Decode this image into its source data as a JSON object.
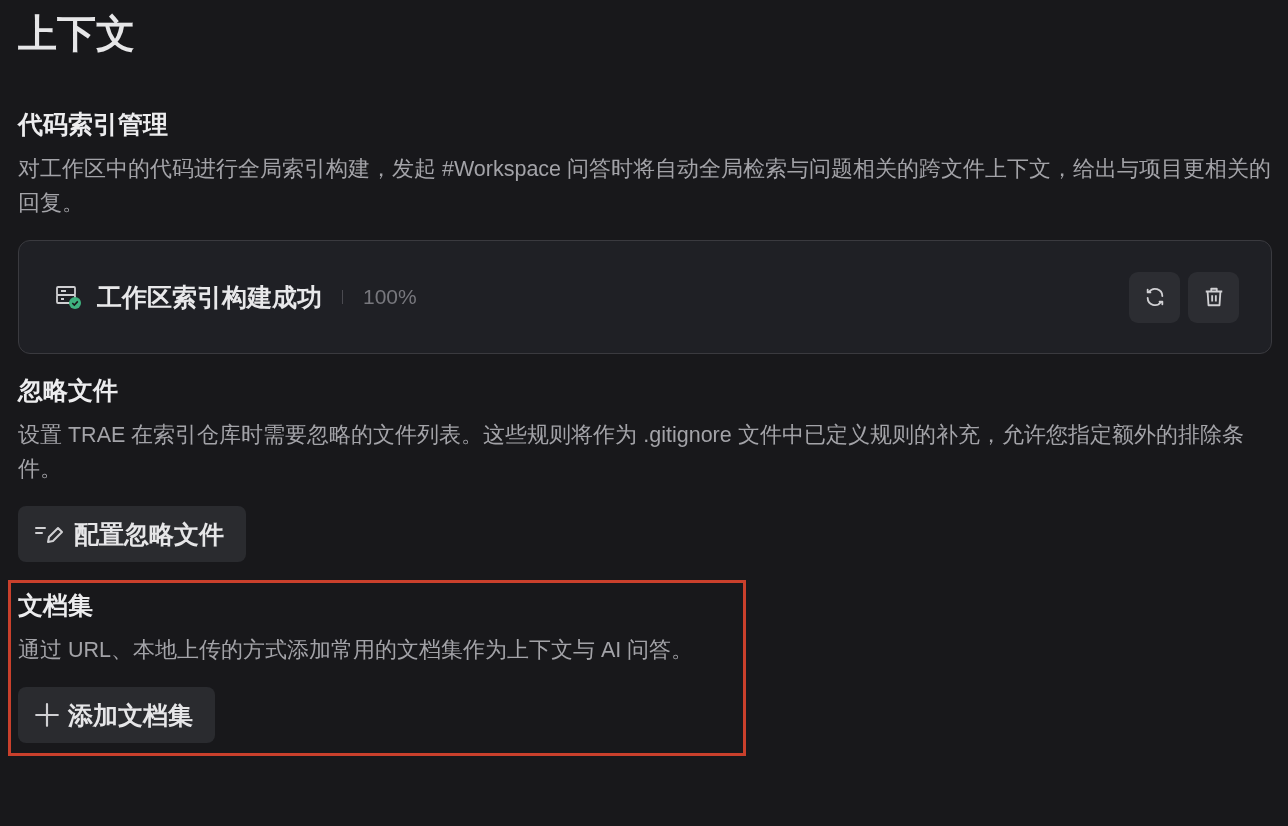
{
  "title": "上下文",
  "sections": [
    {
      "kind": "index",
      "heading": "代码索引管理",
      "description": "对工作区中的代码进行全局索引构建，发起 #Workspace 问答时将自动全局检索与问题相关的跨文件上下文，给出与项目更相关的回复。",
      "highlighted": false,
      "status": {
        "ok": true,
        "label": "工作区索引构建成功",
        "percent": "100%"
      },
      "actions": [
        {
          "kind": "refresh"
        },
        {
          "kind": "delete"
        }
      ]
    },
    {
      "kind": "button",
      "heading": "忽略文件",
      "description": "设置 TRAE 在索引仓库时需要忽略的文件列表。这些规则将作为 .gitignore 文件中已定义规则的补充，允许您指定额外的排除条件。",
      "highlighted": false,
      "button": {
        "kind": "edit",
        "label": "配置忽略文件"
      }
    },
    {
      "kind": "button",
      "heading": "文档集",
      "description": "通过 URL、本地上传的方式添加常用的文档集作为上下文与 AI 问答。",
      "highlighted": true,
      "button": {
        "kind": "add",
        "label": "添加文档集"
      }
    }
  ]
}
